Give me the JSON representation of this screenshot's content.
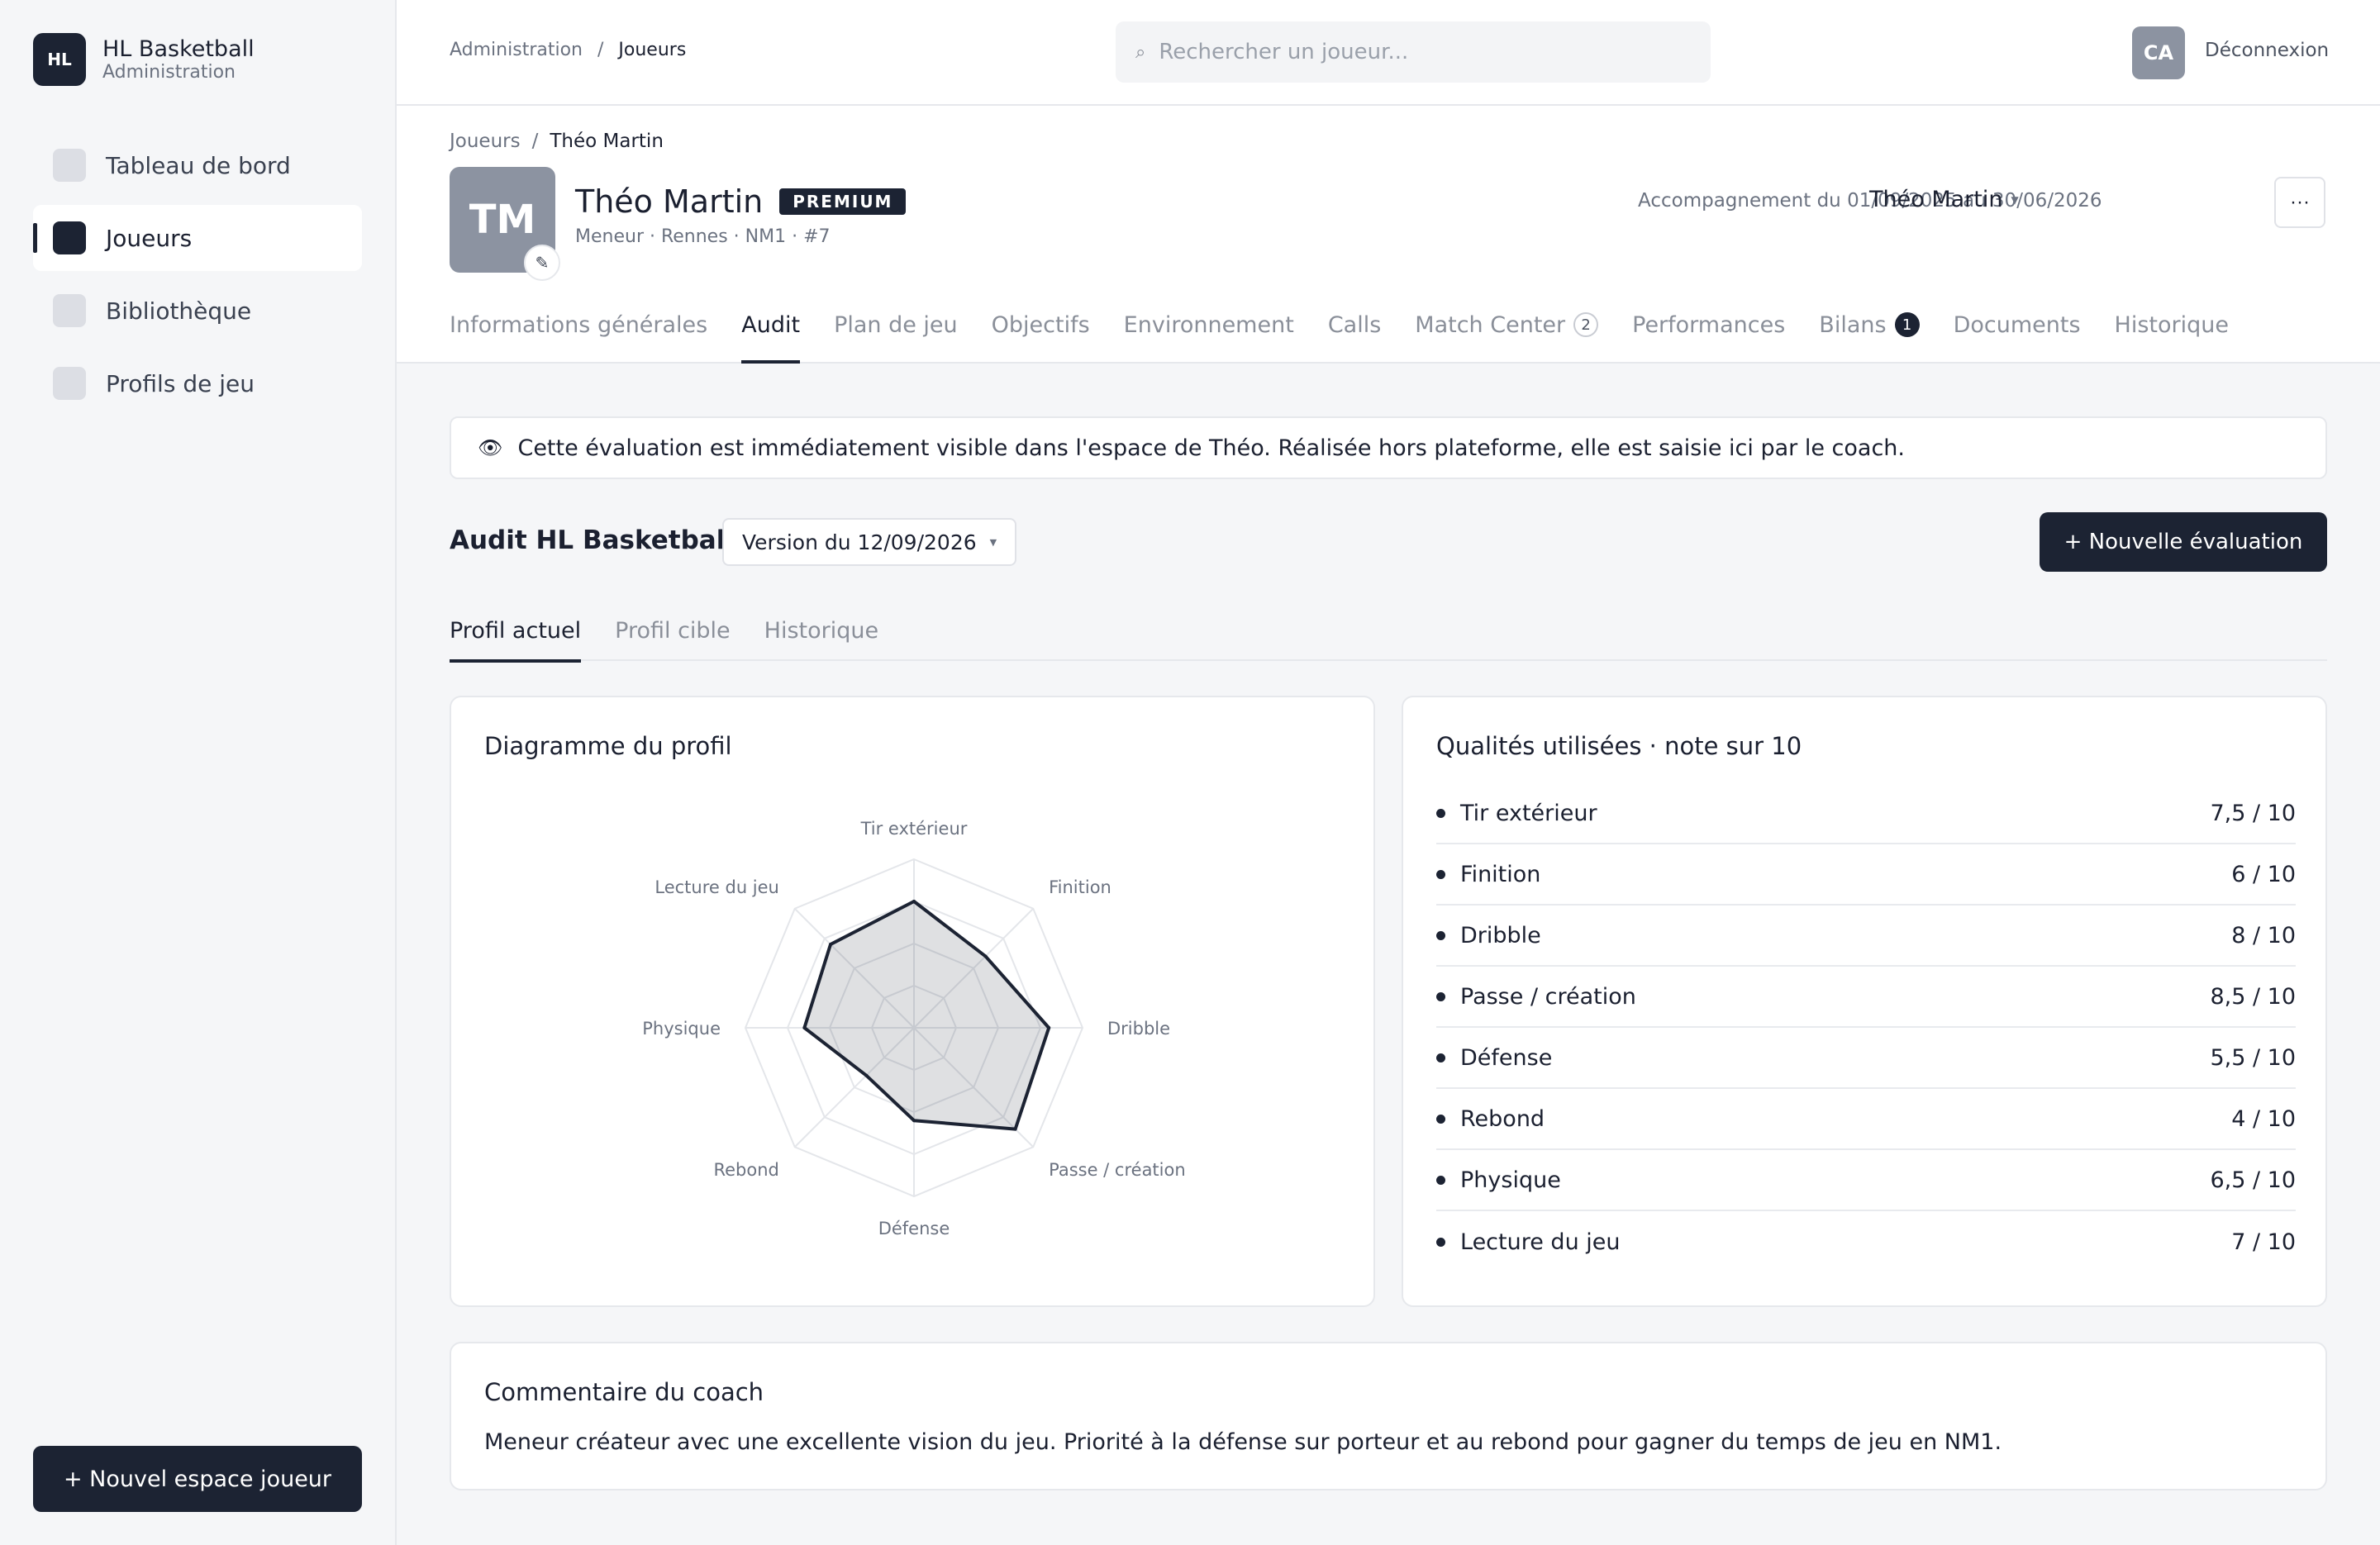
{
  "brand": {
    "logo": "HL",
    "title": "HL Basketball",
    "subtitle": "Administration"
  },
  "sidebar": {
    "items": [
      {
        "label": "Tableau de bord",
        "active": false
      },
      {
        "label": "Joueurs",
        "active": true
      },
      {
        "label": "Bibliothèque",
        "active": false
      },
      {
        "label": "Profils de jeu",
        "active": false
      }
    ],
    "new_space_button": "+ Nouvel espace joueur"
  },
  "topbar": {
    "breadcrumb": [
      "Administration",
      "/",
      "Joueurs"
    ],
    "search_placeholder": "Rechercher un joueur...",
    "search_icon": "search-icon",
    "user_initials": "CA",
    "logout": "Déconnexion"
  },
  "header": {
    "breadcrumb": [
      "Joueurs",
      "/",
      "Théo Martin"
    ],
    "avatar_initials": "TM",
    "edit_icon": "✎",
    "name": "Théo Martin",
    "badge": "PREMIUM",
    "meta": "Meneur · Rennes · NM1 · #7",
    "accompaniment": "Accompagnement du 01/09/2025 au 30/06/2026",
    "player_select": "Théo Martin",
    "more": "···",
    "tabs": [
      {
        "label": "Informations générales",
        "active": false
      },
      {
        "label": "Audit",
        "active": true
      },
      {
        "label": "Plan de jeu",
        "active": false
      },
      {
        "label": "Objectifs",
        "active": false
      },
      {
        "label": "Environnement",
        "active": false
      },
      {
        "label": "Calls",
        "active": false
      },
      {
        "label": "Match Center",
        "active": false,
        "count": "2",
        "count_style": "outline"
      },
      {
        "label": "Performances",
        "active": false
      },
      {
        "label": "Bilans",
        "active": false,
        "count": "1",
        "count_style": "filled"
      },
      {
        "label": "Documents",
        "active": false
      },
      {
        "label": "Historique",
        "active": false
      }
    ]
  },
  "banner": {
    "icon": "👁",
    "text": "Cette évaluation est immédiatement visible dans l'espace de Théo. Réalisée hors plateforme, elle est saisie ici par le coach."
  },
  "audit": {
    "title": "Audit HL Basketball",
    "version": "Version du 12/09/2026",
    "new_eval_button": "+ Nouvelle évaluation",
    "subtabs": [
      {
        "label": "Profil actuel",
        "active": true
      },
      {
        "label": "Profil cible",
        "active": false
      },
      {
        "label": "Historique",
        "active": false
      }
    ]
  },
  "radar_card": {
    "title": "Diagramme du profil"
  },
  "chart_data": {
    "type": "radar",
    "title": "Diagramme du profil",
    "categories": [
      "Tir extérieur",
      "Finition",
      "Dribble",
      "Passe / création",
      "Défense",
      "Rebond",
      "Physique",
      "Lecture du jeu"
    ],
    "values": [
      7.5,
      6,
      8,
      8.5,
      5.5,
      4,
      6.5,
      7
    ],
    "max": 10,
    "rings": 4
  },
  "qualities_card": {
    "title": "Qualités utilisées · note sur 10",
    "items": [
      {
        "label": "Tir extérieur",
        "score": "7,5 / 10"
      },
      {
        "label": "Finition",
        "score": "6 / 10"
      },
      {
        "label": "Dribble",
        "score": "8 / 10"
      },
      {
        "label": "Passe / création",
        "score": "8,5 / 10"
      },
      {
        "label": "Défense",
        "score": "5,5 / 10"
      },
      {
        "label": "Rebond",
        "score": "4 / 10"
      },
      {
        "label": "Physique",
        "score": "6,5 / 10"
      },
      {
        "label": "Lecture du jeu",
        "score": "7 / 10"
      }
    ]
  },
  "comment_card": {
    "title": "Commentaire du coach",
    "text": "Meneur créateur avec une excellente vision du jeu. Priorité à la défense sur porteur et au rebond pour gagner du temps de jeu en NM1."
  },
  "colors": {
    "primary": "#1c2333",
    "muted": "#8a8f99",
    "background": "#f5f6f8"
  }
}
